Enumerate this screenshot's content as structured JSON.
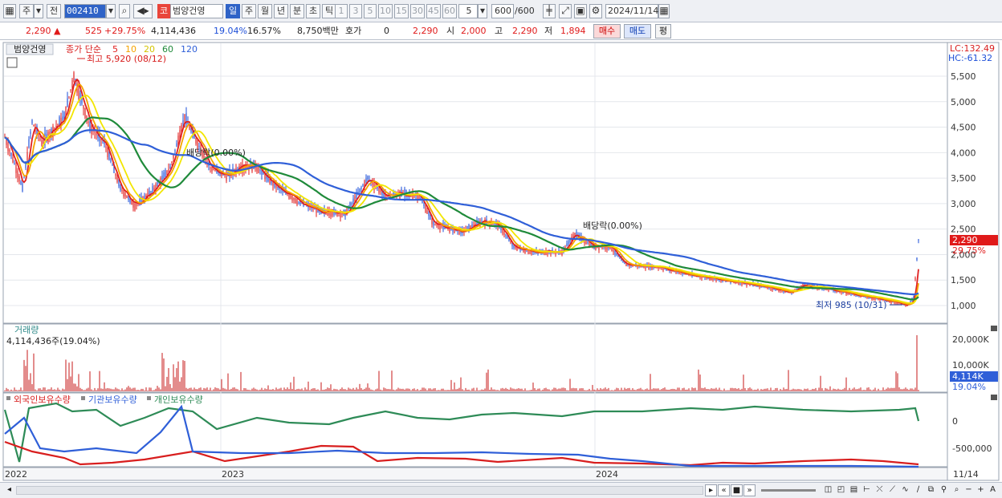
{
  "toolbar": {
    "market": "주",
    "mode": "전",
    "code": "002410",
    "stock_name": "범양건영",
    "stock_tag": "코",
    "periods": [
      "일",
      "주",
      "월",
      "년",
      "분",
      "초",
      "틱"
    ],
    "active_period": "일",
    "intervals": [
      "1",
      "3",
      "5",
      "10",
      "15",
      "30",
      "45",
      "60"
    ],
    "unit_value": "5",
    "count_value": "600",
    "count_total": "/600",
    "date": "2024/11/14"
  },
  "quote": {
    "price": "2,290",
    "change": "525",
    "change_pct": "+29.75%",
    "volume": "4,114,436",
    "vol_pct": "19.04%",
    "turnover": "16.57%",
    "amount": "8,750백만",
    "hoga_label": "호가",
    "hoga_value": "0",
    "current": "2,290",
    "open_label": "시",
    "open": "2,000",
    "high_label": "고",
    "high": "2,290",
    "low_label": "저",
    "low": "1,894",
    "buy_label": "매수",
    "sell_label": "매도",
    "avg_label": "평"
  },
  "chart": {
    "price_legend_name": "범양건영",
    "ma_legend_prefix": "종가 단순",
    "ma_periods": [
      "5",
      "10",
      "20",
      "60",
      "120"
    ],
    "ma_colors": [
      "#e02020",
      "#f5a300",
      "#f2e600",
      "#1f8a3a",
      "#2f5fd8"
    ],
    "lc_label": "LC:132.49",
    "hc_label": "HC:-61.32",
    "high_note": "최고 5,920 (08/12)",
    "low_note": "최저 985 (10/31)",
    "dividend_note": "배당락(0.00%)",
    "price_badge": "2,290",
    "price_badge_pct": "29.75%",
    "y_ticks": [
      "5,500",
      "5,000",
      "4,500",
      "4,000",
      "3,500",
      "3,000",
      "2,500",
      "2,000",
      "1,500",
      "1,000"
    ],
    "volume_title": "거래량",
    "volume_note": "4,114,436주(19.04%)",
    "volume_ticks": [
      "20,000K",
      "10,000K"
    ],
    "volume_badge": "4,114K",
    "volume_badge_pct": "19.04%",
    "holdings_legend": [
      "외국인보유수량",
      "기관보유수량",
      "개인보유수량"
    ],
    "holdings_colors": [
      "#d81e1e",
      "#2f5fd8",
      "#2e8b57"
    ],
    "holdings_ticks": [
      "0",
      "-500,000"
    ],
    "x_labels": [
      "2022",
      "2023",
      "2024"
    ],
    "x_right_label": "11/14"
  }
}
